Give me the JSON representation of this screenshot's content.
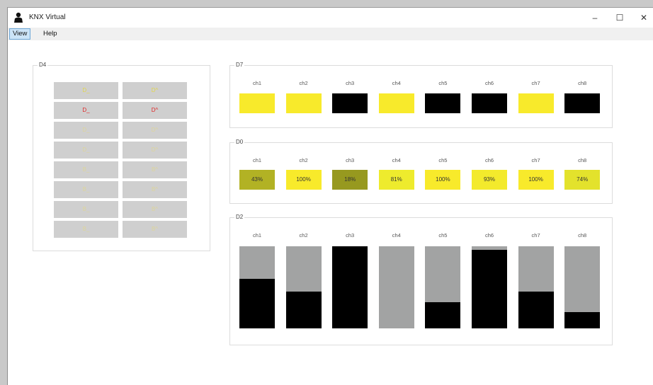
{
  "window": {
    "title": "KNX Virtual"
  },
  "menu": {
    "items": [
      "View",
      "Help"
    ]
  },
  "d4": {
    "label": "D4",
    "buttons": [
      [
        "D_",
        "D^"
      ],
      [
        "D_",
        "D^"
      ],
      [
        "D_",
        "D^"
      ],
      [
        "D_",
        "D^"
      ],
      [
        "B_",
        "B^"
      ],
      [
        "B_",
        "B^"
      ],
      [
        "B_",
        "B^"
      ],
      [
        "B_",
        "B^"
      ]
    ],
    "colors": {
      "yellow": "#e2d64a",
      "red": "#e02626",
      "yellow_dim": "#ddd59a"
    }
  },
  "d7": {
    "label": "D7",
    "channels": [
      {
        "label": "ch1",
        "state": "on"
      },
      {
        "label": "ch2",
        "state": "on"
      },
      {
        "label": "ch3",
        "state": "off"
      },
      {
        "label": "ch4",
        "state": "on"
      },
      {
        "label": "ch5",
        "state": "off"
      },
      {
        "label": "ch6",
        "state": "off"
      },
      {
        "label": "ch7",
        "state": "on"
      },
      {
        "label": "ch8",
        "state": "off"
      }
    ],
    "colors": {
      "on": "#f8ea2b",
      "off": "#000000"
    }
  },
  "d0": {
    "label": "D0",
    "channels": [
      {
        "label": "ch1",
        "value": "43%",
        "color": "#b2b224"
      },
      {
        "label": "ch2",
        "value": "100%",
        "color": "#f8ea2b"
      },
      {
        "label": "ch3",
        "value": "18%",
        "color": "#97991f"
      },
      {
        "label": "ch4",
        "value": "81%",
        "color": "#eeeb2d"
      },
      {
        "label": "ch5",
        "value": "100%",
        "color": "#f8ea2b"
      },
      {
        "label": "ch6",
        "value": "93%",
        "color": "#f3ea2c"
      },
      {
        "label": "ch7",
        "value": "100%",
        "color": "#f8ea2b"
      },
      {
        "label": "ch8",
        "value": "74%",
        "color": "#e3e22c"
      }
    ]
  },
  "d2": {
    "label": "D2",
    "channels": [
      {
        "label": "ch1",
        "level": 0.6
      },
      {
        "label": "ch2",
        "level": 0.45
      },
      {
        "label": "ch3",
        "level": 1.0
      },
      {
        "label": "ch4",
        "level": 0.0
      },
      {
        "label": "ch5",
        "level": 0.32
      },
      {
        "label": "ch6",
        "level": 0.96
      },
      {
        "label": "ch7",
        "level": 0.45
      },
      {
        "label": "ch8",
        "level": 0.2
      }
    ],
    "colors": {
      "track": "#a2a3a3",
      "fill": "#000000"
    }
  }
}
